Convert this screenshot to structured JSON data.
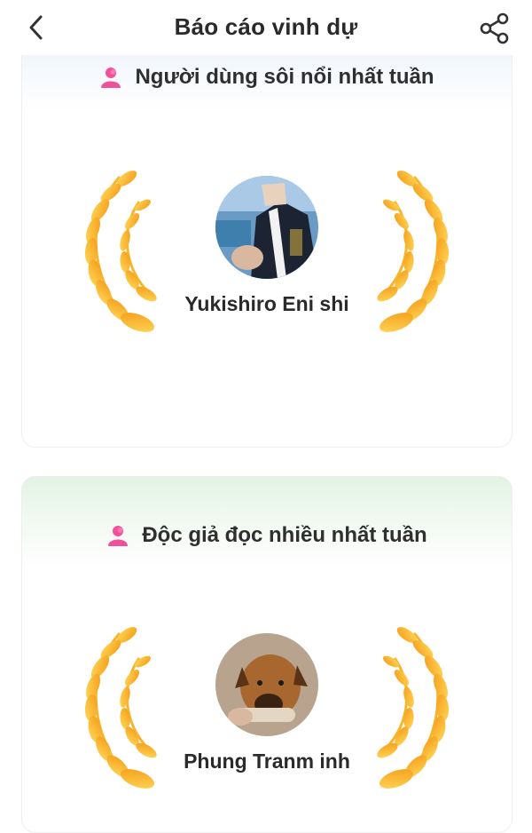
{
  "header": {
    "title": "Báo cáo vinh dự",
    "back_icon": "chevron-left-icon",
    "share_icon": "share-icon"
  },
  "cards": [
    {
      "heading": "Người dùng sôi nổi nhất tuần",
      "user_name": "Yukishiro Eni shi",
      "icon": "user-icon",
      "decoration": "laurel-wreath"
    },
    {
      "heading": "Độc giả đọc nhiều nhất tuần",
      "user_name": "Phung Tranm inh",
      "icon": "user-icon",
      "decoration": "laurel-wreath"
    }
  ],
  "colors": {
    "icon_pink": "#f0509a",
    "wreath_light": "#ffd24a",
    "wreath_dark": "#f7a21c",
    "card1_tint": "#eef4fb",
    "card2_tint": "#e3f4e3"
  }
}
